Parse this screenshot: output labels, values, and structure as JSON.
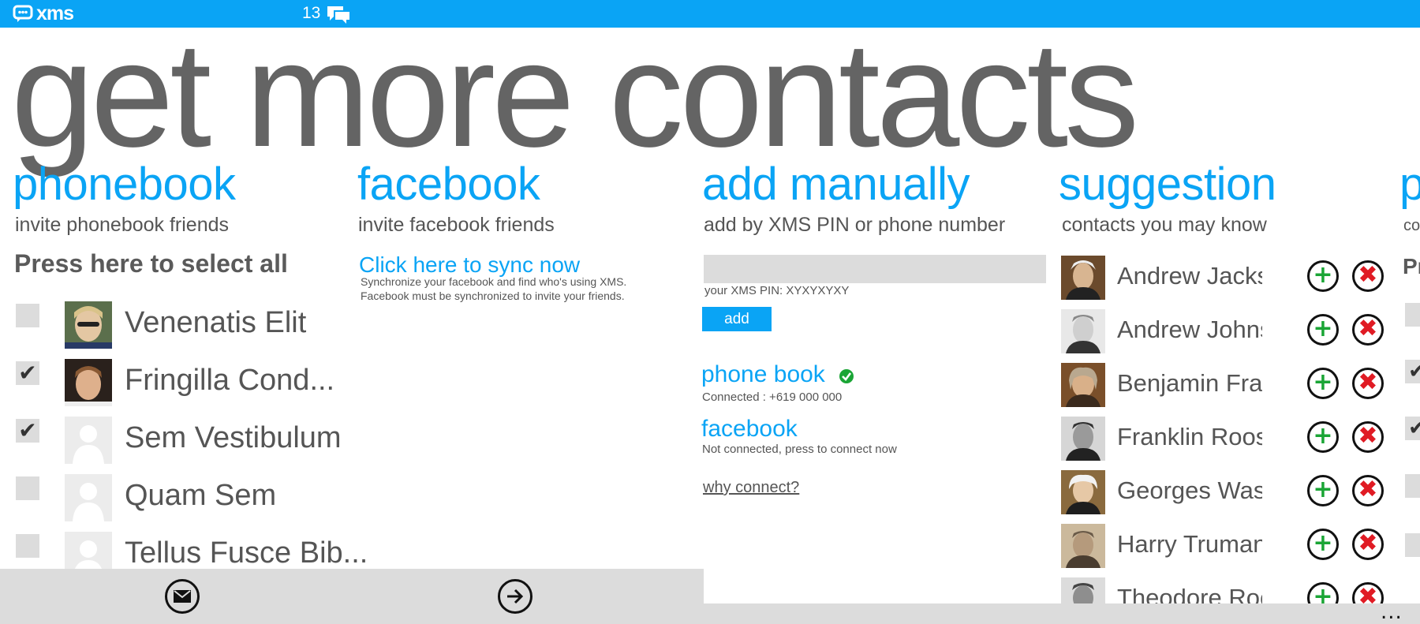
{
  "topbar": {
    "app_name": "xms",
    "message_count": "13"
  },
  "page_title": "get more contacts",
  "phonebook": {
    "title": "phonebook",
    "subtitle": "invite phonebook friends",
    "select_all": "Press here to select all",
    "contacts": [
      {
        "name": "Venenatis Elit",
        "checked": false,
        "has_photo": true
      },
      {
        "name": "Fringilla Cond...",
        "checked": true,
        "has_photo": true
      },
      {
        "name": "Sem Vestibulum",
        "checked": true,
        "has_photo": false
      },
      {
        "name": "Quam Sem",
        "checked": false,
        "has_photo": false
      },
      {
        "name": "Tellus Fusce Bib...",
        "checked": false,
        "has_photo": false
      }
    ]
  },
  "facebook": {
    "title": "facebook",
    "subtitle": "invite facebook friends",
    "sync_link": "Click here to sync now",
    "sync_desc_1": "Synchronize your facebook and find who's using XMS.",
    "sync_desc_2": "Facebook must be synchronized to invite your friends."
  },
  "add_manually": {
    "title": "add manually",
    "subtitle": "add by XMS PIN or phone number",
    "input_value": "",
    "pin_label": "your XMS PIN: XYXYXYXY",
    "add_button": "add",
    "phone_book_title": "phone book",
    "phone_book_status": "Connected : +619 000 000",
    "facebook_title": "facebook",
    "facebook_status": "Not connected, press to connect now",
    "why_connect": "why connect?"
  },
  "suggestion": {
    "title": "suggestion",
    "subtitle": "contacts you may know",
    "people": [
      {
        "name": "Andrew Jackson"
      },
      {
        "name": "Andrew Johnson"
      },
      {
        "name": "Benjamin Franklin"
      },
      {
        "name": "Franklin Roosevelt"
      },
      {
        "name": "Georges Washington"
      },
      {
        "name": "Harry Truman"
      },
      {
        "name": "Theodore Roosevelt"
      }
    ]
  },
  "peek_panel": {
    "title_fragment": "p",
    "subtitle_fragment": "co",
    "select_fragment": "Pr"
  },
  "appbar": {
    "more": "..."
  },
  "colors": {
    "accent": "#0aa4f5",
    "add_green": "#1aa535",
    "remove_red": "#e01b24"
  }
}
